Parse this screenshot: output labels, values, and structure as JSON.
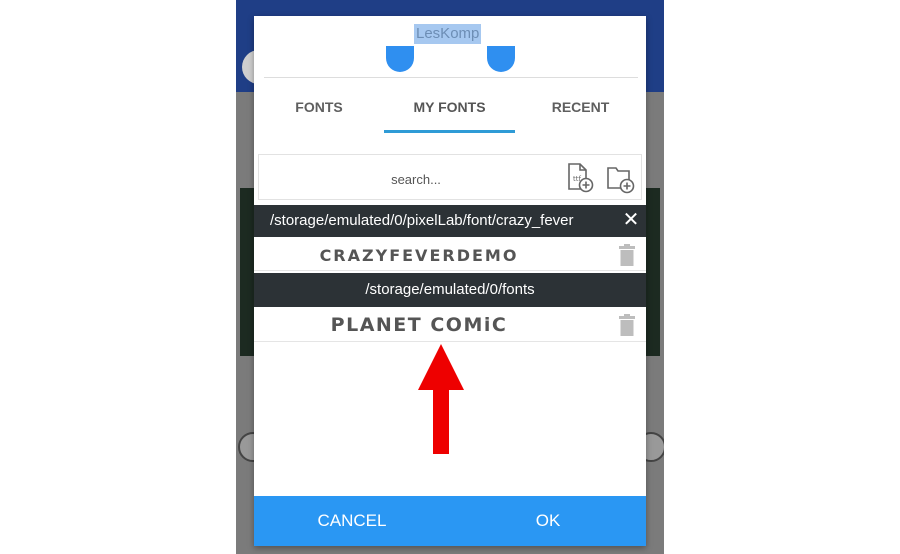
{
  "dialog": {
    "title": "LesKomp",
    "tabs": [
      {
        "label": "FONTS",
        "active": false
      },
      {
        "label": "MY FONTS",
        "active": true
      },
      {
        "label": "RECENT",
        "active": false
      }
    ],
    "search": {
      "placeholder": "search..."
    },
    "icons": {
      "add_file": "add-file-icon",
      "add_folder": "add-folder-icon",
      "close": "close-icon",
      "delete": "trash-icon"
    },
    "folders": [
      {
        "path": "/storage/emulated/0/pixelLab/font/crazy_fever",
        "fonts": [
          "CRAZYFEVERDEMO"
        ]
      },
      {
        "path": "/storage/emulated/0/fonts",
        "fonts": [
          "PLANET COMiC"
        ]
      }
    ],
    "actions": {
      "cancel": "CANCEL",
      "ok": "OK"
    },
    "colors": {
      "accent": "#2a97f3",
      "tab_indicator": "#2f9bd6",
      "path_bar": "#2c3236",
      "annotation_arrow": "#ee0000"
    }
  }
}
